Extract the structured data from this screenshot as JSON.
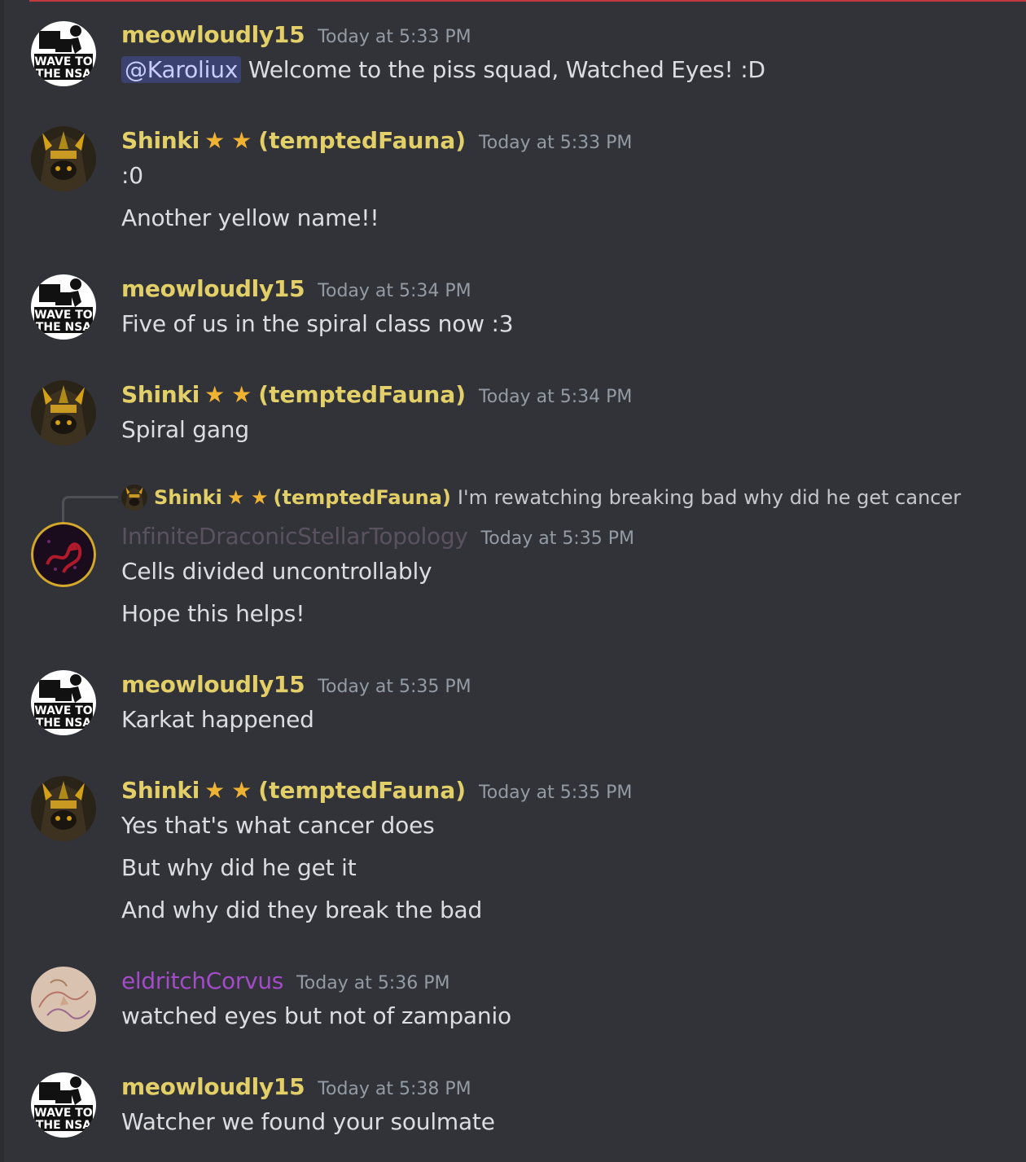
{
  "colors": {
    "meow": "#e3cf68",
    "shinki": "#e3cf68",
    "infinite": "#5b5260",
    "eldritch": "#a34bc8",
    "star": "#f0b232"
  },
  "messages": [
    {
      "user": "meowloudly15",
      "timestamp": "Today at 5:33 PM",
      "mention": "@Karoliux",
      "lines": [
        "Welcome to the piss squad, Watched Eyes! :D"
      ]
    },
    {
      "user": "Shinki",
      "stars": [
        "★",
        "★"
      ],
      "tag": "(temptedFauna)",
      "timestamp": "Today at 5:33 PM",
      "lines": [
        ":0",
        "Another yellow name!!"
      ]
    },
    {
      "user": "meowloudly15",
      "timestamp": "Today at 5:34 PM",
      "lines": [
        "Five of us in the spiral class now :3"
      ]
    },
    {
      "user": "Shinki",
      "stars": [
        "★",
        "★"
      ],
      "tag": "(temptedFauna)",
      "timestamp": "Today at 5:34 PM",
      "lines": [
        "Spiral gang"
      ]
    },
    {
      "reply": {
        "user": "Shinki",
        "stars": [
          "★",
          "★"
        ],
        "tag": "(temptedFauna)",
        "text": "I'm rewatching breaking bad why did he get cancer"
      },
      "user": "InfiniteDraconicStellarTopology",
      "timestamp": "Today at 5:35 PM",
      "lines": [
        "Cells divided uncontrollably",
        "Hope this helps!"
      ]
    },
    {
      "user": "meowloudly15",
      "timestamp": "Today at 5:35 PM",
      "lines": [
        "Karkat happened"
      ]
    },
    {
      "user": "Shinki",
      "stars": [
        "★",
        "★"
      ],
      "tag": "(temptedFauna)",
      "timestamp": "Today at 5:35 PM",
      "lines": [
        "Yes that's what cancer does",
        "But why did he get it",
        "And why did they break the bad"
      ]
    },
    {
      "user": "eldritchCorvus",
      "timestamp": "Today at 5:36 PM",
      "lines": [
        "watched eyes but not of zampanio"
      ]
    },
    {
      "user": "meowloudly15",
      "timestamp": "Today at 5:38 PM",
      "lines": [
        "Watcher we found your soulmate"
      ]
    }
  ]
}
